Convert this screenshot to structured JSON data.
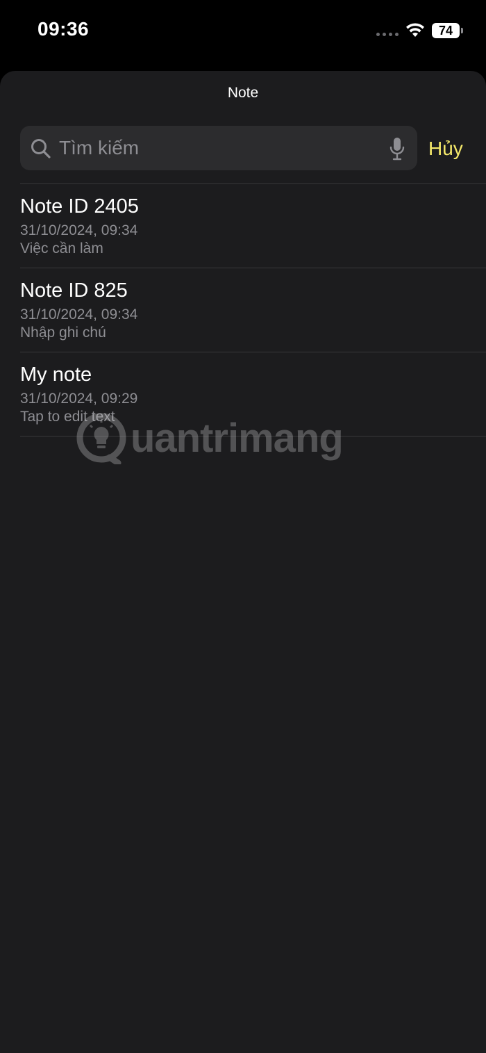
{
  "status_bar": {
    "time": "09:36",
    "battery_level": "74",
    "icons": [
      "signal-dots-icon",
      "wifi-icon",
      "battery-icon"
    ]
  },
  "sheet": {
    "title": "Note"
  },
  "search": {
    "placeholder": "Tìm kiếm",
    "value": "",
    "icon": "search-icon",
    "mic_icon": "microphone-icon",
    "cancel_label": "Hủy",
    "cancel_color": "#f5e96a"
  },
  "notes": [
    {
      "title": "Note ID 2405",
      "date": "31/10/2024, 09:34",
      "preview": "Việc cần làm"
    },
    {
      "title": "Note ID 825",
      "date": "31/10/2024, 09:34",
      "preview": "Nhập ghi chú"
    },
    {
      "title": "My note",
      "date": "31/10/2024, 09:29",
      "preview": "Tap to edit text"
    }
  ],
  "watermark": {
    "text": "uantrimang",
    "icon": "lightbulb-logo-icon"
  },
  "colors": {
    "background": "#000000",
    "sheet": "#1c1c1e",
    "search_field": "#2c2c2e",
    "separator": "#38383a",
    "secondary_text": "#8e8e93",
    "accent": "#f5e96a"
  }
}
